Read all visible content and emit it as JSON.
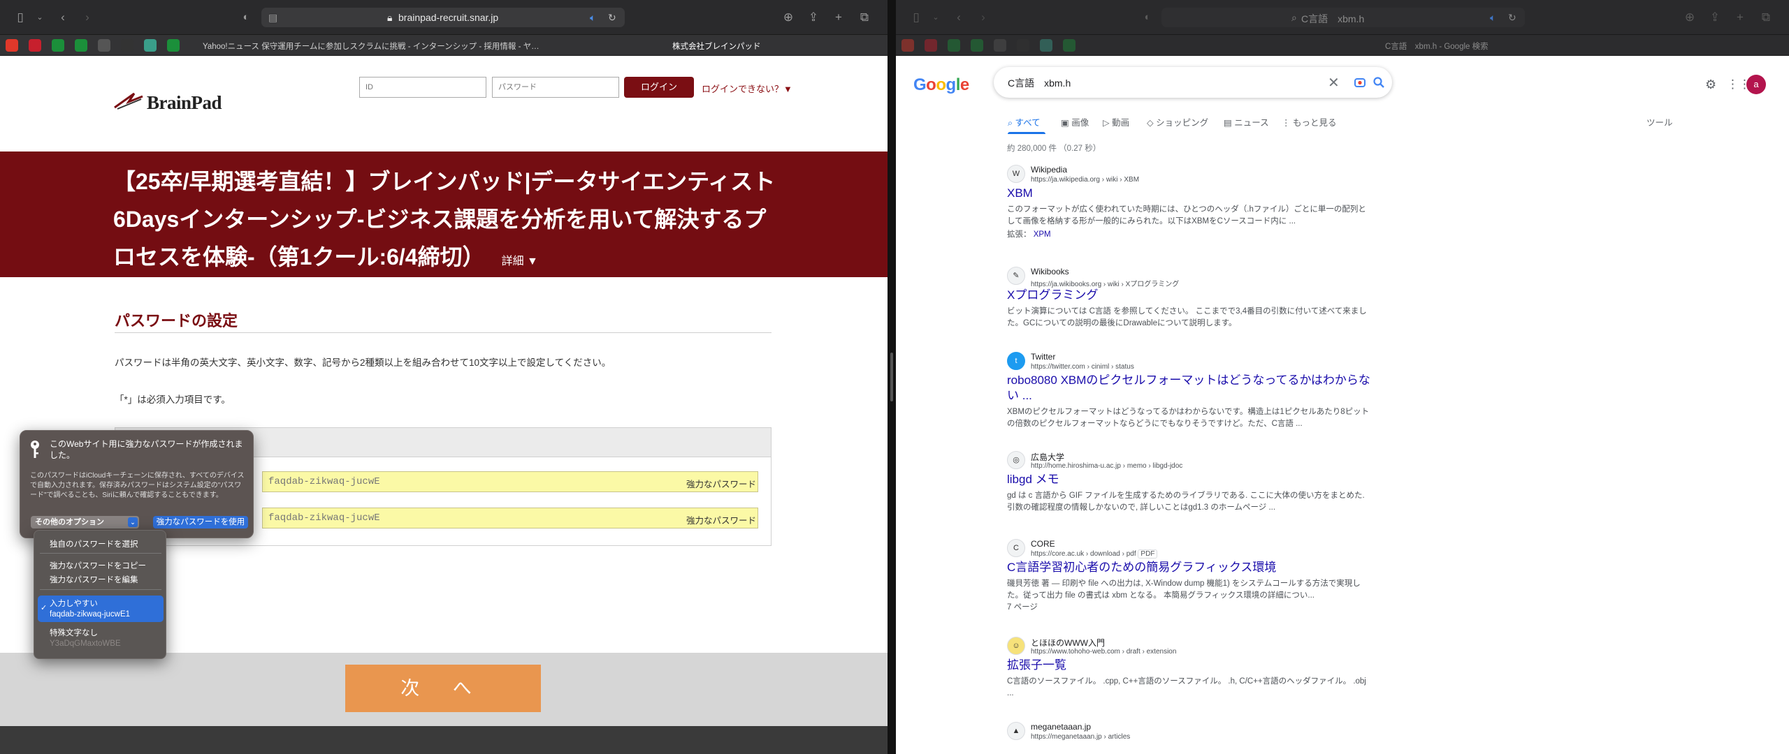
{
  "left": {
    "url": "brainpad-recruit.snar.jp",
    "bookmarks": [
      {
        "color": "#e0382a"
      },
      {
        "color": "#c7202d"
      },
      {
        "color": "#1b8f3a"
      },
      {
        "color": "#1b8f3a"
      },
      {
        "color": "#555555"
      },
      {
        "color": "#333333"
      },
      {
        "color": "#3a9e8a"
      },
      {
        "color": "#1b8f3a"
      }
    ],
    "tab_inactive": "Yahoo!ニュース 保守運用チームに参加しスクラムに挑戦 - インターンシップ - 採用情報 - ヤ…",
    "tab_active": "株式会社ブレインパッド",
    "logo_text": "BrainPad",
    "login": {
      "id_placeholder": "ID",
      "pw_placeholder": "パスワード",
      "button": "ログイン",
      "help": "ログインできない？▼"
    },
    "banner": {
      "title": "【25卒/早期選考直結！】ブレインパッド|データサイエンティスト6Daysインターンシップ-ビジネス課題を分析を用いて解決するプロセスを体験-（第1クール:6/4締切）",
      "detail": "詳細 ▼"
    },
    "section_title": "パスワードの設定",
    "instruction": "パスワードは半角の英大文字、英小文字、数字、記号から2種類以上を組み合わせて10文字以上で設定してください。",
    "required_note": "「*」は必須入力項目です。",
    "password_value": "faqdab-zikwaq-jucwE",
    "strong_label": "強力なパスワード",
    "next_button": "次 へ",
    "popover": {
      "headline": "このWebサイト用に強力なパスワードが作成されました。",
      "body": "このパスワードはiCloudキーチェーンに保存され、すべてのデバイスで自動入力されます。保存済みパスワードはシステム設定の\"パスワード\"で調べることも、Siriに頼んで確認することもできます。",
      "other_options": "その他のオプション",
      "use_strong": "強力なパスワードを使用"
    },
    "menu": {
      "choose_own": "独自のパスワードを選択",
      "copy_strong": "強力なパスワードをコピー",
      "edit_strong": "強力なパスワードを編集",
      "easy_label": "入力しやすい",
      "easy_value": "faqdab-zikwaq-jucwE1",
      "no_special": "特殊文字なし",
      "no_special_value": "Y3aDqGMaxtoWBE"
    }
  },
  "right": {
    "url_query": "C言語　xbm.h",
    "tab_title": "C言語　xbm.h - Google 検索",
    "search_query": "C言語　xbm.h",
    "tabs": [
      "すべて",
      "画像",
      "動画",
      "ショッピング",
      "ニュース",
      "もっと見る"
    ],
    "tools": "ツール",
    "result_count": "約 280,000 件 （0.27 秒）",
    "results": [
      {
        "fav": "W",
        "site": "Wikipedia",
        "crumb": "https://ja.wikipedia.org › wiki › XBM",
        "title": "XBM",
        "snippet": "このフォーマットが広く使われていた時期には、ひとつのヘッダ（.hファイル）ごとに単一の配列として画像を格納する形が一般的にみられた。以下はXBMをCソースコード内に ...",
        "extra_label": "拡張：",
        "extra_link": "XPM"
      },
      {
        "fav": "✎",
        "site": "Wikibooks",
        "crumb": "https://ja.wikibooks.org › wiki › Xプログラミング",
        "title": "Xプログラミング",
        "snippet": "ビット演算については C言語 を参照してください。 ここまでで3,4番目の引数に付いて述べて来ました。GCについての説明の最後にDrawableについて説明します。"
      },
      {
        "fav": "t",
        "site": "Twitter",
        "crumb": "https://twitter.com › ciniml › status",
        "title": "robo8080 XBMのピクセルフォーマットはどうなってるかはわからない ...",
        "snippet": "XBMのピクセルフォーマットはどうなってるかはわからないです。構造上は1ピクセルあたり8ピットの倍数のピクセルフォーマットならどうにでもなりそうですけど。ただ、C言語 ..."
      },
      {
        "fav": "◎",
        "site": "広島大学",
        "crumb": "http://home.hiroshima-u.ac.jp › memo › libgd-jdoc",
        "title": "libgd メモ",
        "snippet": "gd は c 言語から GIF ファイルを生成するためのライブラリである. ここに大体の使い方をまとめた. 引数の確認程度の情報しかないので, 詳しいことはgd1.3 のホームページ ..."
      },
      {
        "fav": "C",
        "site": "CORE",
        "crumb": "https://core.ac.uk › download › pdf",
        "pdf": "PDF",
        "title": "C言語学習初心者のための簡易グラフィックス環境",
        "snippet": "磯貝芳徳 著 — 印刷や file への出力は, X-Window dump 機能1) をシステムコールする方法で実現した。従って出力 file の書式は xbm となる。 本簡易グラフィックス環境の詳細につい...",
        "meta": "7 ページ"
      },
      {
        "fav": "☺",
        "site": "とほほのWWW入門",
        "crumb": "https://www.tohoho-web.com › draft › extension",
        "title": "拡張子一覧",
        "snippet": "C言語のソースファイル。 .cpp, C++言語のソースファイル。 .h, C/C++言語のヘッダファイル。 .obj ..."
      },
      {
        "fav": "▲",
        "site": "meganetaaan.jp",
        "crumb": "https://meganetaaan.jp › articles",
        "title": ""
      }
    ]
  }
}
